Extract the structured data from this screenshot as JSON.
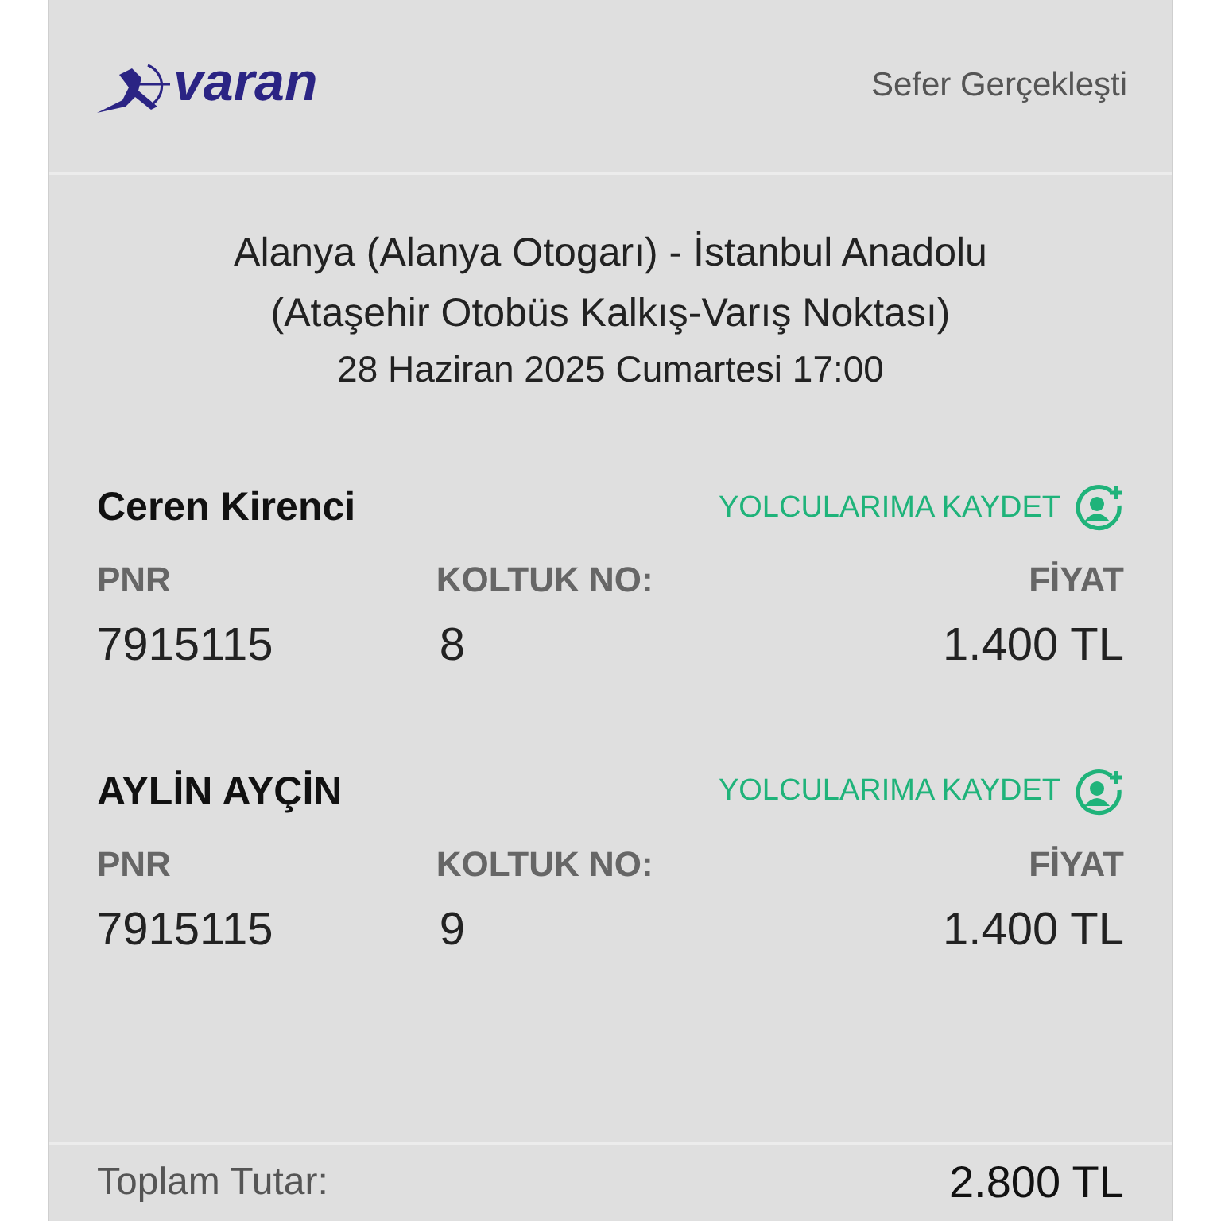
{
  "header": {
    "logo_text": "varan",
    "status": "Sefer Gerçekleşti"
  },
  "trip": {
    "route_line_1": "Alanya (Alanya Otogarı) - İstanbul Anadolu",
    "route_line_2": "(Ataşehir Otobüs Kalkış-Varış Noktası)",
    "date": "28 Haziran 2025 Cumartesi 17:00"
  },
  "passengers": [
    {
      "name": "Ceren Kirenci",
      "save_link": "YOLCULARIMA KAYDET",
      "pnr_label": "PNR",
      "pnr": "7915115",
      "seat_label": "KOLTUK NO:",
      "seat": "8",
      "price_label": "FİYAT",
      "price": "1.400 TL"
    },
    {
      "name": "AYLİN AYÇİN",
      "save_link": "YOLCULARIMA KAYDET",
      "pnr_label": "PNR",
      "pnr": "7915115",
      "seat_label": "KOLTUK NO:",
      "seat": "9",
      "price_label": "FİYAT",
      "price": "1.400 TL"
    }
  ],
  "total": {
    "label": "Toplam Tutar:",
    "value": "2.800 TL"
  }
}
